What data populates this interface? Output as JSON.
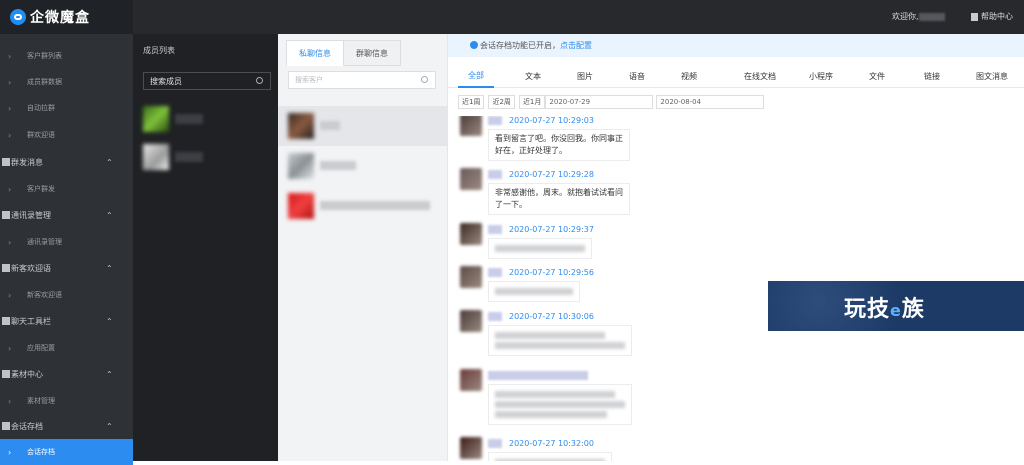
{
  "header": {
    "brand": "企微魔盒",
    "welcome": "欢迎你,",
    "help": "帮助中心"
  },
  "sidebar": {
    "items": [
      {
        "label": "客户群列表",
        "kind": "sub"
      },
      {
        "label": "成员群数据",
        "kind": "sub"
      },
      {
        "label": "自动拉群",
        "kind": "sub"
      },
      {
        "label": "群欢迎语",
        "kind": "sub"
      },
      {
        "label": "群发消息",
        "kind": "group"
      },
      {
        "label": "客户群发",
        "kind": "sub"
      },
      {
        "label": "通讯录管理",
        "kind": "group"
      },
      {
        "label": "通讯录管理",
        "kind": "sub"
      },
      {
        "label": "新客欢迎语",
        "kind": "group"
      },
      {
        "label": "新客欢迎语",
        "kind": "sub"
      },
      {
        "label": "聊天工具栏",
        "kind": "group"
      },
      {
        "label": "应用配置",
        "kind": "sub"
      },
      {
        "label": "素材中心",
        "kind": "group"
      },
      {
        "label": "素材管理",
        "kind": "sub"
      },
      {
        "label": "会话存档",
        "kind": "group"
      },
      {
        "label": "会话存档",
        "kind": "sub",
        "active": true
      }
    ]
  },
  "members": {
    "title": "成员列表",
    "search_value": "搜索成员"
  },
  "chats": {
    "tabs": [
      "私聊信息",
      "群聊信息"
    ],
    "search_placeholder": "搜索客户"
  },
  "main": {
    "notice_text": "会话存档功能已开启，",
    "notice_link": "点击配置",
    "types": [
      "全部",
      "文本",
      "图片",
      "语音",
      "视频",
      "在线文档",
      "小程序",
      "文件",
      "链接",
      "图文消息"
    ],
    "quick_ranges": [
      "近1周",
      "近2周",
      "近1月"
    ],
    "date_start": "2020-07-29",
    "date_end": "2020-08-04",
    "messages": [
      {
        "time": "2020-07-27 10:29:03",
        "lines": [
          "看到留言了吧。你没回我。你同事正",
          "好在，正好处理了。"
        ]
      },
      {
        "time": "2020-07-27 10:29:28",
        "lines": [
          "非常感谢他，周末。就抱着试试看问",
          "了一下。"
        ]
      },
      {
        "time": "2020-07-27 10:29:37",
        "lines": []
      },
      {
        "time": "2020-07-27 10:29:56",
        "lines": []
      },
      {
        "time": "2020-07-27 10:30:06",
        "lines": []
      },
      {
        "time": "",
        "lines": []
      },
      {
        "time": "2020-07-27 10:32:00",
        "lines": []
      }
    ]
  },
  "ad": {
    "text": "玩技",
    "e": "e",
    "text2": "族"
  },
  "colors": {
    "accent": "#2d8cf0",
    "sidebar": "#2e3136",
    "topbar": "#27292d"
  }
}
